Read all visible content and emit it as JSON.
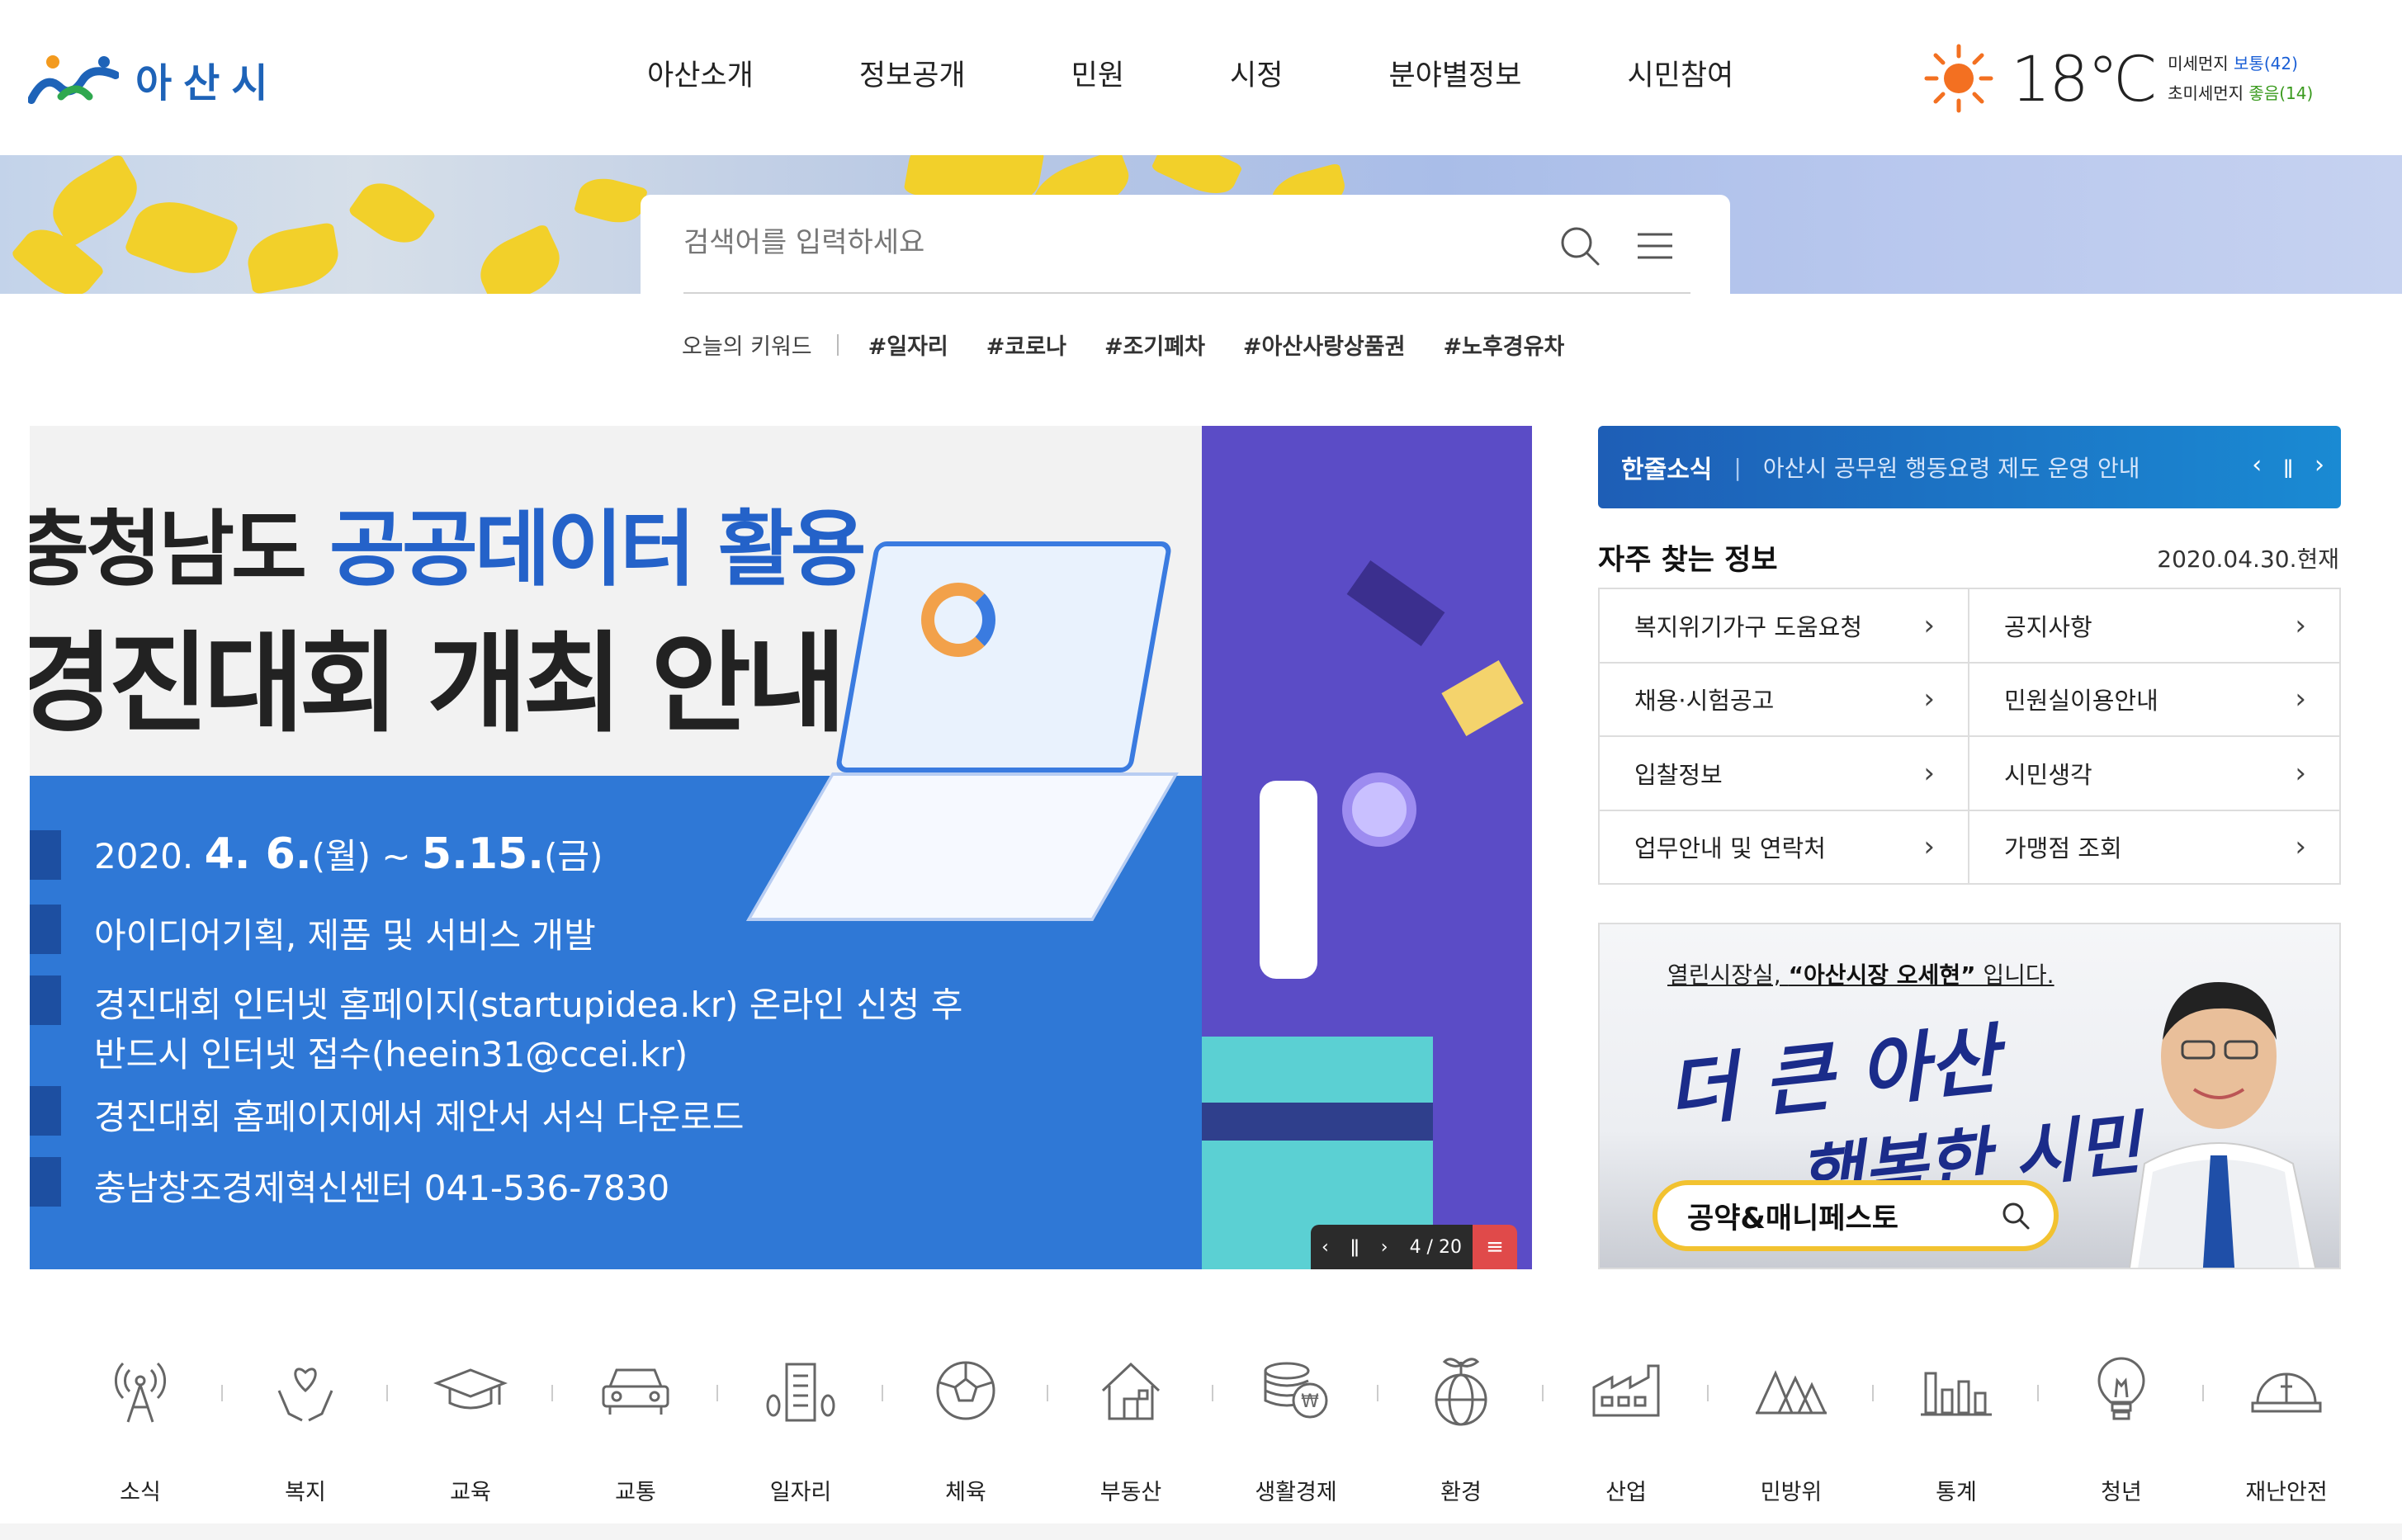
{
  "header": {
    "logo_text": "아산시",
    "nav": [
      "아산소개",
      "정보공개",
      "민원",
      "시정",
      "분야별정보",
      "시민참여"
    ],
    "weather": {
      "temp": "18℃",
      "fine_dust_label": "미세먼지",
      "fine_dust_value": "보통(42)",
      "ultrafine_dust_label": "초미세먼지",
      "ultrafine_dust_value": "좋음(14)"
    }
  },
  "search": {
    "placeholder": "검색어를 입력하세요",
    "keywords_label": "오늘의 키워드",
    "keywords": [
      "#일자리",
      "#코로나",
      "#조기폐차",
      "#아산사랑상품권",
      "#노후경유차"
    ]
  },
  "slider": {
    "title_line1_a": "충청남도 ",
    "title_line1_b": "공공데이터 활용",
    "title_line2": "경진대회 개최 안내",
    "date_pre": "2020. ",
    "date_b1": "4. 6.",
    "date_mid1": "(월) ~ ",
    "date_b2": "5.15.",
    "date_mid2": "(금)",
    "line2": "아이디어기획, 제품 및 서비스 개발",
    "line3a": "경진대회 인터넷 홈페이지(startupidea.kr) 온라인 신청 후",
    "line3b": "반드시 인터넷 접수(heein31@ccei.kr)",
    "line4": "경진대회 홈페이지에서 제안서 서식 다운로드",
    "line5": "충남창조경제혁신센터 041-536-7830",
    "counter": "4 / 20",
    "current": 4,
    "total": 20
  },
  "oneline": {
    "label": "한줄소식",
    "text": "아산시 공무원 행동요령 제도 운영 안내"
  },
  "favorites": {
    "title": "자주 찾는 정보",
    "date": "2020.04.30.현재",
    "items": [
      "복지위기가구 도움요청",
      "공지사항",
      "채용·시험공고",
      "민원실이용안내",
      "입찰정보",
      "시민생각",
      "업무안내 및 연락처",
      "가맹점 조회"
    ]
  },
  "mayor": {
    "caption_pre": "열린시장실, ",
    "caption_b": "“아산시장 오세현”",
    "caption_post": " 입니다.",
    "slogan1": "더 큰 아산",
    "slogan2": "행복한 시민",
    "pledge_label": "공약&매니페스토"
  },
  "categories": [
    "소식",
    "복지",
    "교육",
    "교통",
    "일자리",
    "체육",
    "부동산",
    "생활경제",
    "환경",
    "산업",
    "민방위",
    "통계",
    "청년",
    "재난안전"
  ],
  "colors": {
    "brand_blue": "#1e63b8",
    "slide_blue": "#2f78d6",
    "slide_purple": "#5b4cc6",
    "accent_red": "#e04a4a",
    "pledge_yellow": "#f2c230",
    "sun_orange": "#f37021"
  }
}
